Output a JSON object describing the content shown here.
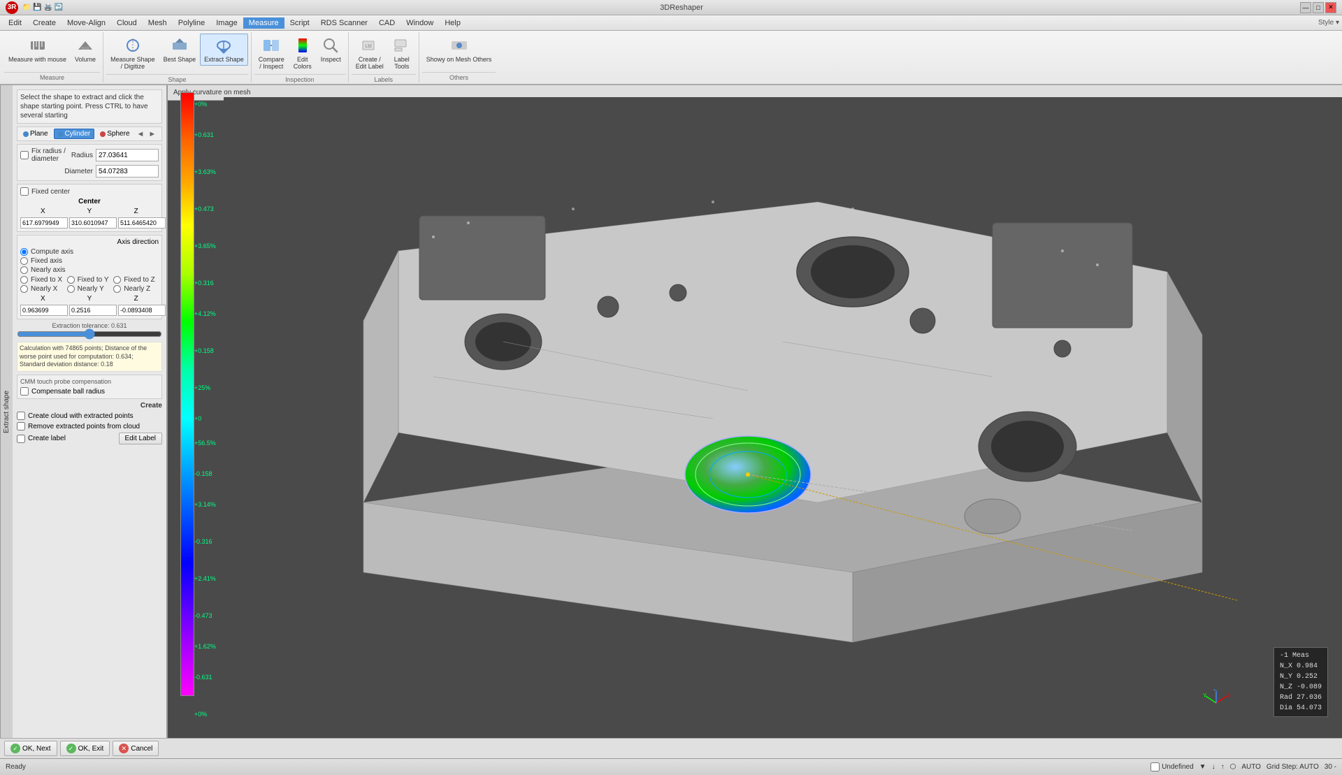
{
  "app": {
    "title": "3DReshaper",
    "logo": "3R"
  },
  "title_bar": {
    "title": "3DReshaper",
    "minimize": "—",
    "maximize": "□",
    "close": "✕"
  },
  "menu": {
    "items": [
      "Edit",
      "Create",
      "Move-Align",
      "Cloud",
      "Mesh",
      "Polyline",
      "Image",
      "Measure",
      "Script",
      "RDS Scanner",
      "CAD",
      "Window",
      "Help"
    ],
    "active": "Measure",
    "style": "Style ▾"
  },
  "toolbar": {
    "groups": [
      {
        "label": "Measure",
        "items": [
          {
            "icon": "ruler-icon",
            "label": "Measure\nwith mouse"
          },
          {
            "icon": "volume-icon",
            "label": "Volume"
          }
        ]
      },
      {
        "label": "Shape",
        "items": [
          {
            "icon": "measure-shape-icon",
            "label": "Measure Shape\n/ Digitize"
          },
          {
            "icon": "best-shape-icon",
            "label": "Best\nShape"
          },
          {
            "icon": "extract-shape-icon",
            "label": "Extract\nShape"
          }
        ]
      },
      {
        "label": "Inspection",
        "items": [
          {
            "icon": "compare-inspect-icon",
            "label": "Compare\n/ Inspect"
          },
          {
            "icon": "edit-colors-icon",
            "label": "Edit\nColors"
          },
          {
            "icon": "inspect-icon",
            "label": "Inspect"
          }
        ]
      },
      {
        "label": "Labels",
        "items": [
          {
            "icon": "create-edit-label-icon",
            "label": "Create /\nEdit Label"
          },
          {
            "icon": "label-tools-icon",
            "label": "Label\nTools"
          }
        ]
      },
      {
        "label": "Others",
        "items": [
          {
            "icon": "show-others-icon",
            "label": "Showy on Mesh Others"
          }
        ]
      }
    ]
  },
  "viewport_top": {
    "label": "Apply curvature on mesh"
  },
  "left_panel": {
    "section_label": "Extract shape",
    "instructions": "Select the shape to extract and click the shape starting point. Press CTRL to have several starting",
    "shape_tabs": {
      "plane": "Plane",
      "cylinder": "Cylinder",
      "sphere": "Sphere"
    },
    "radius": {
      "label": "Radius",
      "value": "27.03641",
      "fix_label": "Fix radius /\ndiameter"
    },
    "diameter": {
      "label": "Diameter",
      "value": "54.07283"
    },
    "center_label": "Center",
    "fixed_center": "Fixed center",
    "x_label": "X",
    "y_label": "Y",
    "z_label": "Z",
    "x_value": "617.6979949",
    "y_value": "310.6010947",
    "z_value": "511.6465420",
    "axis_direction": "Axis direction",
    "axis_options": {
      "compute_axis": "Compute axis",
      "fixed_axis": "Fixed axis",
      "nearly_axis": "Nearly axis",
      "fixed_x": "Fixed to X",
      "fixed_y": "Fixed to Y",
      "fixed_z": "Fixed to Z",
      "nearly_x": "Nearly X",
      "nearly_y": "Nearly Y",
      "nearly_z": "Nearly Z"
    },
    "axis_x_value": "0.963699",
    "axis_y_value": "0.2516",
    "axis_z_value": "-0.0893408",
    "extraction_tolerance": "Extraction tolerance: 0.631",
    "calc_info": "Calculation with 74865 points; Distance of the worse point used for computation: 0.634; Standard deviation distance: 0.18",
    "cmm_label": "CMM touch probe compensation",
    "compensate_ball_radius": "Compensate\nball radius",
    "create_label": "Create",
    "create_cloud": "Create cloud with extracted points",
    "remove_extracted": "Remove extracted points from cloud",
    "create_label_cb": "Create label",
    "edit_label_btn": "Edit Label"
  },
  "color_bar": {
    "labels": [
      {
        "value": "+0%",
        "top_pct": 1
      },
      {
        "value": "+0.631",
        "top_pct": 7
      },
      {
        "value": "+3.63%",
        "top_pct": 14
      },
      {
        "value": "+0.473",
        "top_pct": 21
      },
      {
        "value": "+3.65%",
        "top_pct": 28
      },
      {
        "value": "+0.316",
        "top_pct": 35
      },
      {
        "value": "+4.12%",
        "top_pct": 42
      },
      {
        "value": "+0.158",
        "top_pct": 49
      },
      {
        "value": "+25%",
        "top_pct": 55
      },
      {
        "value": "+0",
        "top_pct": 62
      },
      {
        "value": "+56.5%",
        "top_pct": 67
      },
      {
        "value": "-0.158",
        "top_pct": 72
      },
      {
        "value": "+3.14%",
        "top_pct": 78
      },
      {
        "value": "-0.316",
        "top_pct": 83
      },
      {
        "value": "+2.41%",
        "top_pct": 89
      },
      {
        "value": "-0.473",
        "top_pct": 93
      },
      {
        "value": "+1.62%",
        "top_pct": 97
      },
      {
        "value": "-0.631",
        "top_pct": 101
      },
      {
        "value": "+0%",
        "top_pct": 107
      }
    ]
  },
  "info_overlay": {
    "line1": "-1    Meas",
    "line2": "N_X  0.984",
    "line3": "N_Y  0.252",
    "line4": "N_Z -0.089",
    "line5": "Rad  27.036",
    "line6": "Dia  54.073"
  },
  "bottom_buttons": {
    "ok_next": "OK, Next",
    "ok_exit": "OK, Exit",
    "cancel": "Cancel"
  },
  "status_bar": {
    "status": "Ready",
    "undefined_label": "Undefined",
    "auto": "AUTO",
    "grid_step": "Grid Step: AUTO",
    "zoom": "30 -"
  }
}
